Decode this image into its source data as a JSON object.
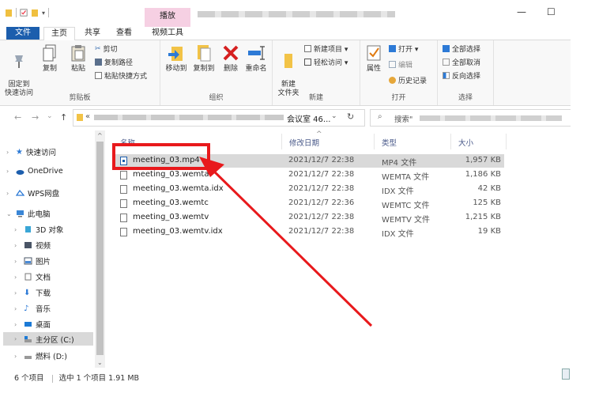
{
  "titlebar": {
    "context_tab": "播放",
    "minimize": "—",
    "maximize": "☐"
  },
  "ribbon_tabs": [
    "文件",
    "主页",
    "共享",
    "查看",
    "视频工具"
  ],
  "ribbon": {
    "clipboard": {
      "pin": "固定到\n快速访问",
      "copy": "复制",
      "paste": "粘贴",
      "cut": "剪切",
      "copy_path": "复制路径",
      "paste_shortcut": "粘贴快捷方式",
      "label": "剪贴板"
    },
    "organize": {
      "move_to": "移动到",
      "copy_to": "复制到",
      "delete": "删除",
      "rename": "重命名",
      "label": "组织"
    },
    "new": {
      "new_folder": "新建\n文件夹",
      "new_item": "新建项目 ▾",
      "easy_access": "轻松访问 ▾",
      "label": "新建"
    },
    "open": {
      "properties": "属性",
      "open": "打开 ▾",
      "edit": "编辑",
      "history": "历史记录",
      "label": "打开"
    },
    "select": {
      "select_all": "全部选择",
      "select_none": "全部取消",
      "invert": "反向选择",
      "label": "选择"
    }
  },
  "nav": {
    "back": "←",
    "forward": "→",
    "recent": "⌄",
    "up": "↑"
  },
  "address": {
    "prefix": "«",
    "folder": "会议室 46...",
    "dropdown": "⌄",
    "refresh": "↻"
  },
  "search": {
    "icon": "⌕",
    "placeholder": "搜索\""
  },
  "navpane": {
    "items": [
      {
        "label": "快速访问",
        "icon": "star-icon"
      },
      {
        "label": "OneDrive",
        "icon": "cloud-icon"
      },
      {
        "label": "WPS网盘",
        "icon": "wps-cloud-icon"
      },
      {
        "label": "此电脑",
        "icon": "computer-icon"
      },
      {
        "label": "3D 对象",
        "icon": "cube-icon"
      },
      {
        "label": "视频",
        "icon": "video-folder-icon"
      },
      {
        "label": "图片",
        "icon": "picture-folder-icon"
      },
      {
        "label": "文档",
        "icon": "document-folder-icon"
      },
      {
        "label": "下载",
        "icon": "download-folder-icon"
      },
      {
        "label": "音乐",
        "icon": "music-folder-icon"
      },
      {
        "label": "桌面",
        "icon": "desktop-folder-icon"
      },
      {
        "label": "主分区 (C:)",
        "icon": "drive-c-icon"
      },
      {
        "label": "燃料 (D:)",
        "icon": "drive-d-icon"
      }
    ]
  },
  "columns": {
    "name": "名称",
    "modified": "修改日期",
    "type": "类型",
    "size": "大小"
  },
  "files": [
    {
      "name": "meeting_03.mp4",
      "date": "2021/12/7 22:38",
      "type": "MP4 文件",
      "size": "1,957 KB",
      "selected": true
    },
    {
      "name": "meeting_03.wemta",
      "date": "2021/12/7 22:38",
      "type": "WEMTA 文件",
      "size": "1,186 KB"
    },
    {
      "name": "meeting_03.wemta.idx",
      "date": "2021/12/7 22:38",
      "type": "IDX 文件",
      "size": "42 KB"
    },
    {
      "name": "meeting_03.wemtc",
      "date": "2021/12/7 22:36",
      "type": "WEMTC 文件",
      "size": "125 KB"
    },
    {
      "name": "meeting_03.wemtv",
      "date": "2021/12/7 22:38",
      "type": "WEMTV 文件",
      "size": "1,215 KB"
    },
    {
      "name": "meeting_03.wemtv.idx",
      "date": "2021/12/7 22:38",
      "type": "IDX 文件",
      "size": "19 KB"
    }
  ],
  "status": {
    "count": "6 个项目",
    "selected": "选中 1 个项目 1.91 MB"
  },
  "annotation": {
    "highlight_color": "#e8191c"
  }
}
